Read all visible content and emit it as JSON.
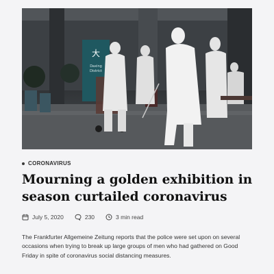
{
  "article": {
    "image": {
      "sign_text": "大",
      "sign_line1": "Daxing",
      "sign_line2": "District"
    },
    "category": "CORONAVIRUS",
    "title": "Mourning a golden exhibition in season curtailed coronavirus",
    "meta": {
      "date": "July 5, 2020",
      "comments": "230",
      "read_time": "3 min read"
    },
    "excerpt": "The Frankfurter Allgemeine Zeitung reports that the police were set upon on several occasions when trying to break up large groups of men who had gathered on Good Friday in spite of coronavirus social distancing measures."
  },
  "icons": {
    "date": "calendar-icon",
    "comments": "comment-icon",
    "read_time": "clock-icon"
  },
  "colors": {
    "text": "#111111",
    "meta": "#444444",
    "background": "#f4f4f6"
  }
}
